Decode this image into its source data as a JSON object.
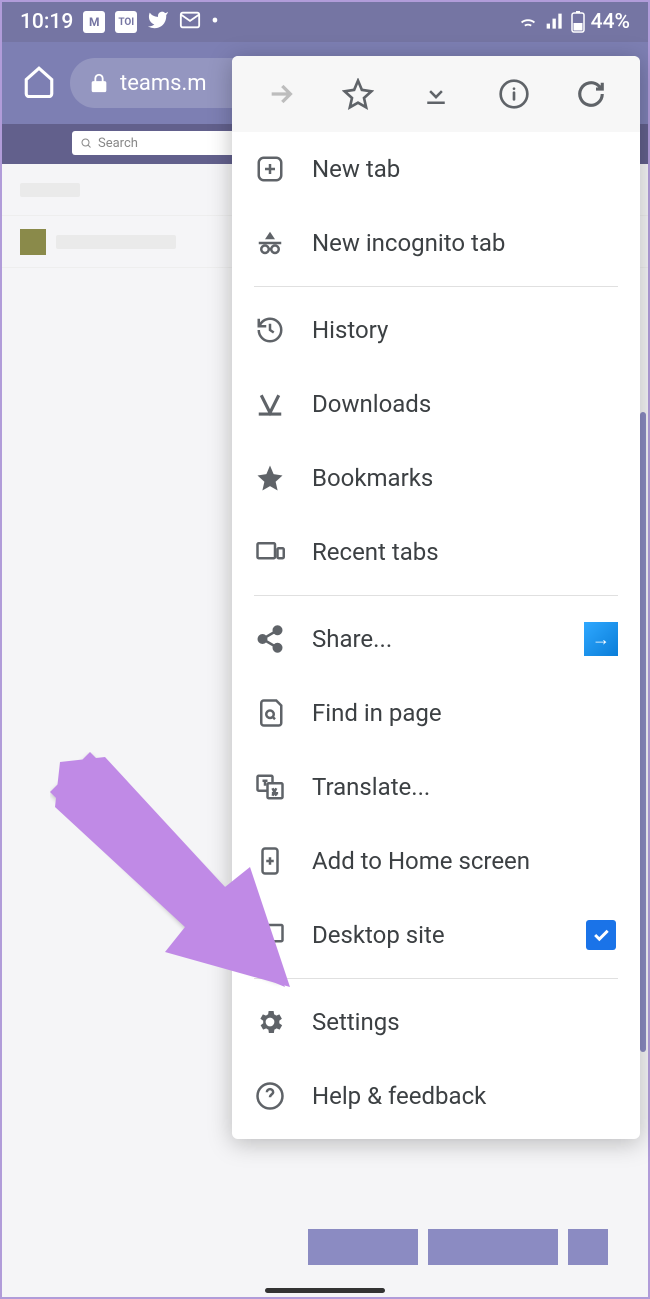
{
  "status": {
    "time": "10:19",
    "battery": "44%"
  },
  "url": {
    "domain": "teams.m"
  },
  "search": {
    "placeholder": "Search"
  },
  "menu": {
    "new_tab": "New tab",
    "incognito": "New incognito tab",
    "history": "History",
    "downloads": "Downloads",
    "bookmarks": "Bookmarks",
    "recent_tabs": "Recent tabs",
    "share": "Share...",
    "find": "Find in page",
    "translate": "Translate...",
    "add_home": "Add to Home screen",
    "desktop": "Desktop site",
    "settings": "Settings",
    "help": "Help & feedback",
    "desktop_checked": true
  }
}
